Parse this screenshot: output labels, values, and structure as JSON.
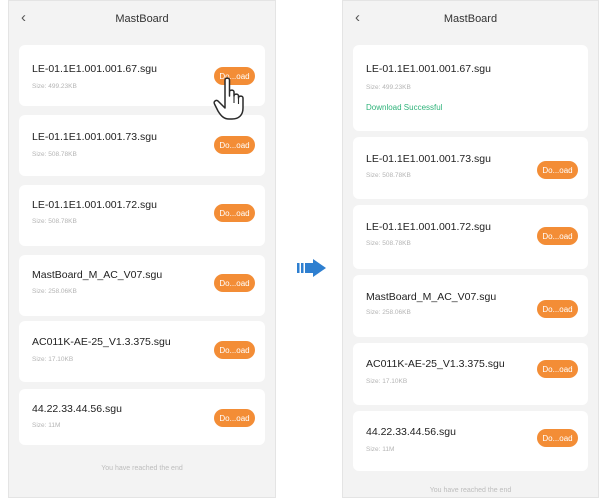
{
  "left_screen": {
    "title": "MastBoard",
    "back_icon": "chevron-left-icon",
    "files": [
      {
        "name": "LE-01.1E1.001.001.67.sgu",
        "size": "Size: 499.23KB",
        "button": "Do...oad"
      },
      {
        "name": "LE-01.1E1.001.001.73.sgu",
        "size": "Size: 508.78KB",
        "button": "Do...oad"
      },
      {
        "name": "LE-01.1E1.001.001.72.sgu",
        "size": "Size: 508.78KB",
        "button": "Do...oad"
      },
      {
        "name": "MastBoard_M_AC_V07.sgu",
        "size": "Size: 258.06KB",
        "button": "Do...oad"
      },
      {
        "name": "AC011K-AE-25_V1.3.375.sgu",
        "size": "Size: 17.10KB",
        "button": "Do...oad"
      },
      {
        "name": "44.22.33.44.56.sgu",
        "size": "Size: 11M",
        "button": "Do...oad"
      }
    ],
    "end_text": "You have reached the end",
    "pointer_icon": "hand-pointer-icon"
  },
  "transition_icon": "right-arrow-icon",
  "right_screen": {
    "title": "MastBoard",
    "back_icon": "chevron-left-icon",
    "files": [
      {
        "name": "LE-01.1E1.001.001.67.sgu",
        "size": "Size: 499.23KB",
        "status": "Download Successful"
      },
      {
        "name": "LE-01.1E1.001.001.73.sgu",
        "size": "Size: 508.78KB",
        "button": "Do...oad"
      },
      {
        "name": "LE-01.1E1.001.001.72.sgu",
        "size": "Size: 508.78KB",
        "button": "Do...oad"
      },
      {
        "name": "MastBoard_M_AC_V07.sgu",
        "size": "Size: 258.06KB",
        "button": "Do...oad"
      },
      {
        "name": "AC011K-AE-25_V1.3.375.sgu",
        "size": "Size: 17.10KB",
        "button": "Do...oad"
      },
      {
        "name": "44.22.33.44.56.sgu",
        "size": "Size: 11M",
        "button": "Do...oad"
      }
    ],
    "end_text": "You have reached the end"
  },
  "colors": {
    "accent": "#f38d36",
    "success": "#2fb37a",
    "background": "#f3f3f3",
    "card": "#ffffff",
    "arrow": "#2e7fd0"
  }
}
